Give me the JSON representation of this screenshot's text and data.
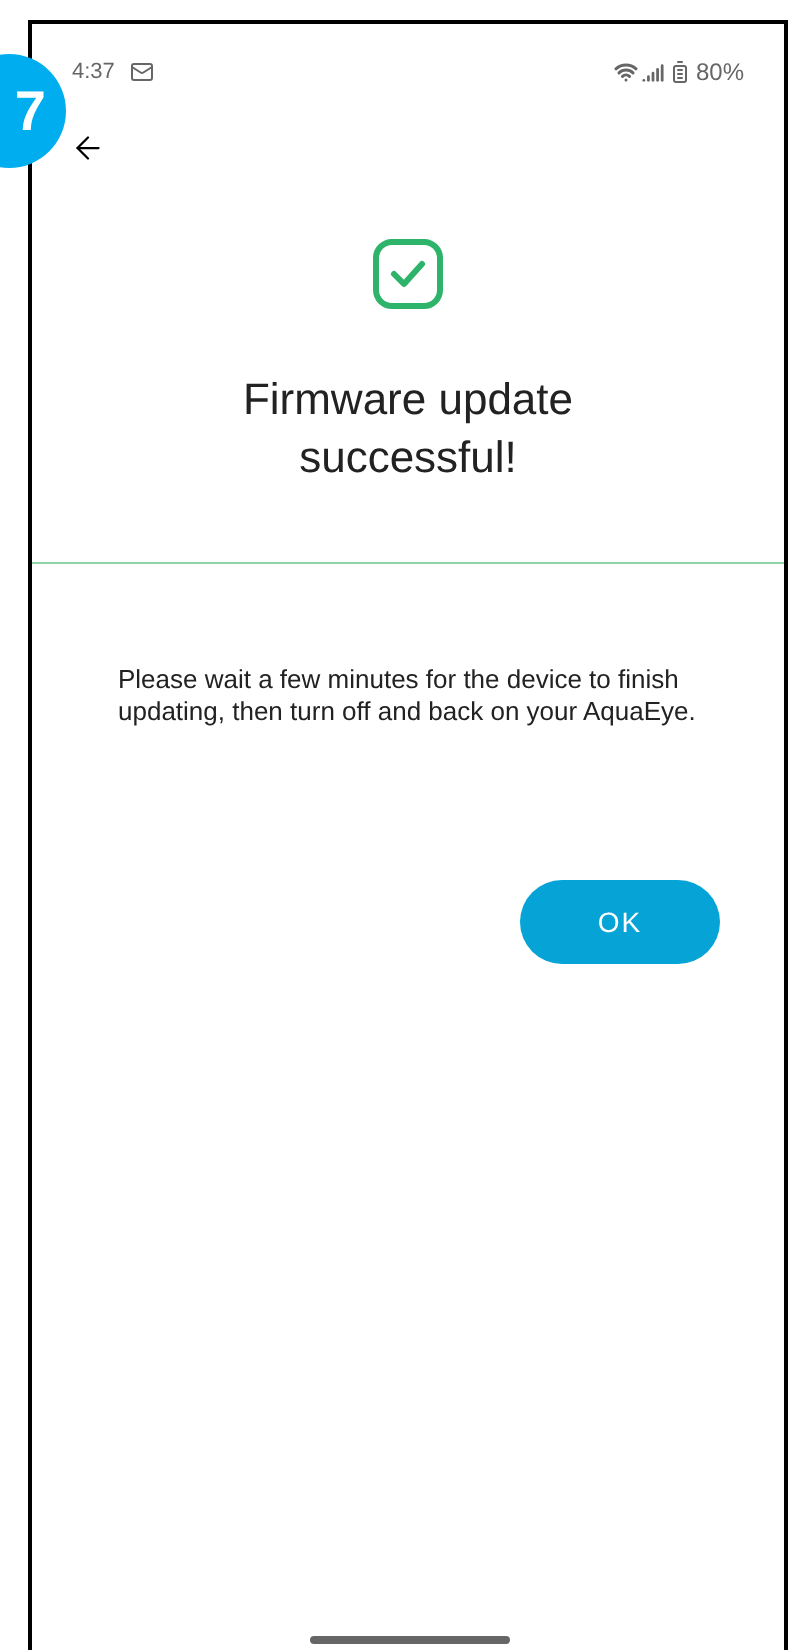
{
  "step_badge": {
    "label": "7"
  },
  "status_bar": {
    "time": "4:37",
    "battery": "80%"
  },
  "title": "Firmware update successful!",
  "message": "Please wait a few minutes for the device to finish updating, then turn off and back on your AquaEye.",
  "buttons": [
    {
      "label": "OK"
    }
  ]
}
